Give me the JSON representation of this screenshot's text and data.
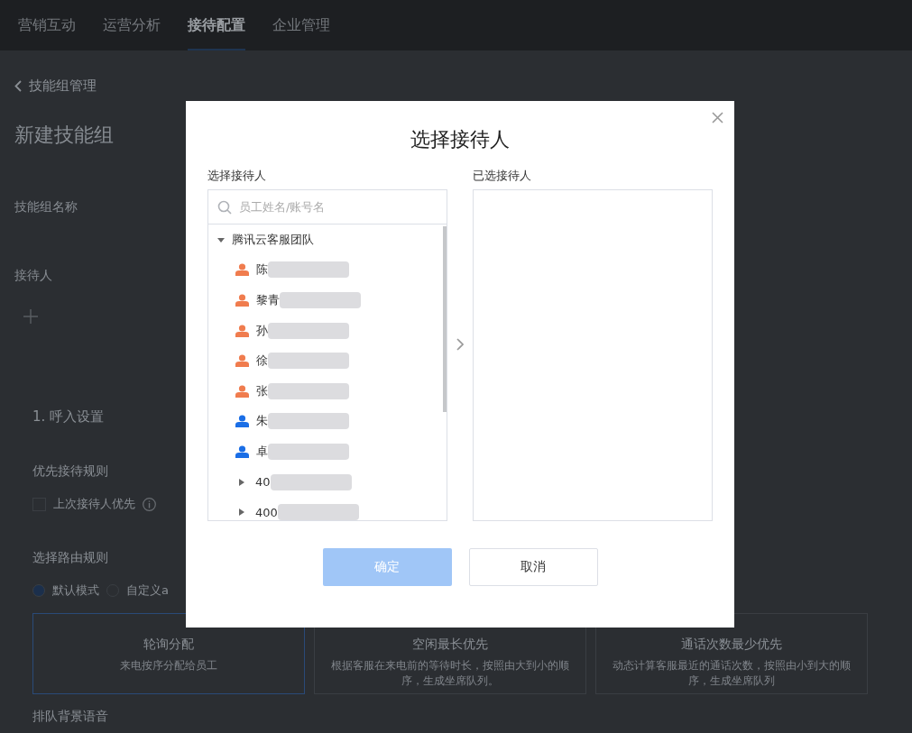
{
  "nav": {
    "tabs": [
      {
        "label": "营销互动",
        "selected": false
      },
      {
        "label": "运营分析",
        "selected": false
      },
      {
        "label": "接待配置",
        "selected": true
      },
      {
        "label": "企业管理",
        "selected": false
      }
    ]
  },
  "page": {
    "back_link": "技能组管理",
    "title": "新建技能组",
    "name_label": "技能组名称",
    "receiver_label": "接待人",
    "section_title": "1. 呼入设置",
    "priority_label": "优先接待规则",
    "priority_option": {
      "label": "上次接待人优先",
      "checked": false
    },
    "routing_label": "选择路由规则",
    "routing_modes": [
      {
        "label": "默认模式",
        "selected": true
      },
      {
        "label": "自定义a",
        "selected": false
      }
    ],
    "cards": [
      {
        "title": "轮询分配",
        "description": "来电按序分配给员工",
        "selected": true
      },
      {
        "title": "空闲最长优先",
        "description": "根据客服在来电前的等待时长，按照由大到小的顺序，生成坐席队列。",
        "selected": false
      },
      {
        "title": "通话次数最少优先",
        "description": "动态计算客服最近的通话次数，按照由小到大的顺序，生成坐席队列",
        "selected": false
      }
    ],
    "bottom_label": "排队背景语音"
  },
  "dialog": {
    "title": "选择接待人",
    "left_label": "选择接待人",
    "search": {
      "placeholder": "员工姓名/账号名"
    },
    "right_label": "已选接待人",
    "tree": [
      {
        "label": "腾讯云客服团队",
        "kind": "group",
        "expanded": true,
        "children": [
          {
            "label": "陈",
            "kind": "person",
            "color": "#f07c4e"
          },
          {
            "label": "黎青",
            "kind": "person",
            "color": "#f07c4e"
          },
          {
            "label": "孙",
            "kind": "person",
            "color": "#f07c4e"
          },
          {
            "label": "徐",
            "kind": "person",
            "color": "#f07c4e"
          },
          {
            "label": "张",
            "kind": "person",
            "color": "#f07c4e"
          },
          {
            "label": "朱",
            "kind": "person",
            "color": "#1a6ee6"
          },
          {
            "label": "卓",
            "kind": "person",
            "color": "#1a6ee6"
          },
          {
            "label": "40",
            "kind": "group",
            "expanded": false
          },
          {
            "label": "400",
            "kind": "group",
            "expanded": false
          }
        ]
      }
    ],
    "buttons": [
      {
        "label": "确定",
        "kind": "primary",
        "disabled": true
      },
      {
        "label": "取消",
        "kind": "secondary",
        "disabled": false
      }
    ]
  }
}
